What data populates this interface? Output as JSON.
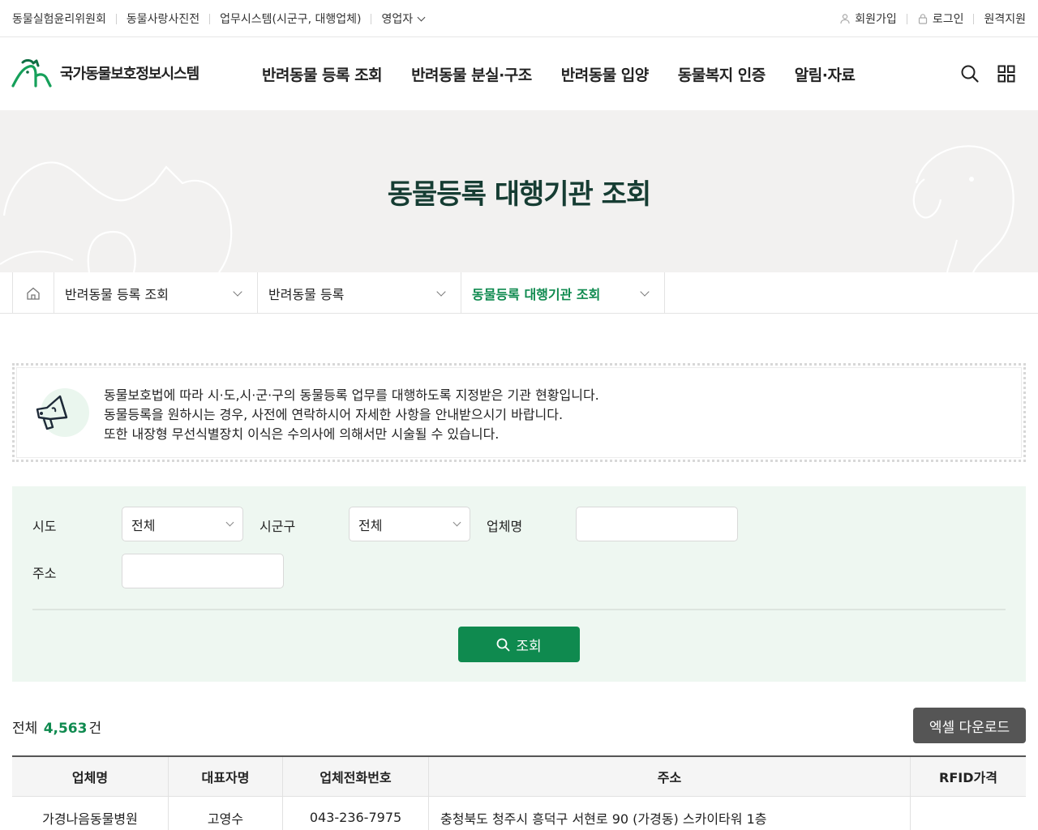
{
  "utility": {
    "left_links": [
      "동물실험윤리위원회",
      "동물사랑사진전",
      "업무시스템(시군구, 대행업체)",
      "영업자"
    ],
    "signup": "회원가입",
    "login": "로그인",
    "remote": "원격지원"
  },
  "header": {
    "logo_text": "국가동물보호정보시스템",
    "nav": [
      "반려동물 등록 조회",
      "반려동물 분실·구조",
      "반려동물 입양",
      "동물복지 인증",
      "알림·자료"
    ]
  },
  "visual": {
    "title": "동물등록 대행기관 조회"
  },
  "breadcrumb": {
    "items": [
      "반려동물 등록 조회",
      "반려동물 등록",
      "동물등록 대행기관 조회"
    ]
  },
  "notice": {
    "lines": [
      "동물보호법에 따라 시·도,시·군·구의 동물등록 업무를 대행하도록 지정받은 기관 현황입니다.",
      "동물등록을 원하시는 경우, 사전에 연락하시어 자세한 사항을 안내받으시기 바랍니다.",
      "또한 내장형 무선식별장치 이식은 수의사에 의해서만 시술될 수 있습니다."
    ]
  },
  "search": {
    "sido_label": "시도",
    "sido_value": "전체",
    "sigungu_label": "시군구",
    "sigungu_value": "전체",
    "company_label": "업체명",
    "company_value": "",
    "address_label": "주소",
    "address_value": "",
    "button": "조회"
  },
  "result": {
    "total_prefix": "전체",
    "total_count": "4,563",
    "total_suffix": "건",
    "excel_button": "엑셀 다운로드"
  },
  "table": {
    "headers": [
      "업체명",
      "대표자명",
      "업체전화번호",
      "주소",
      "RFID가격"
    ],
    "rows": [
      [
        "가경나음동물병원",
        "고영수",
        "043-236-7975",
        "충청북도 청주시 흥덕구 서현로 90 (가경동) 스카이타워 1층",
        ""
      ]
    ]
  },
  "colors": {
    "brand_green": "#0f8a4f",
    "title_dark_green": "#163d33",
    "search_bg": "#eef7f1",
    "excel_btn": "#555555"
  }
}
